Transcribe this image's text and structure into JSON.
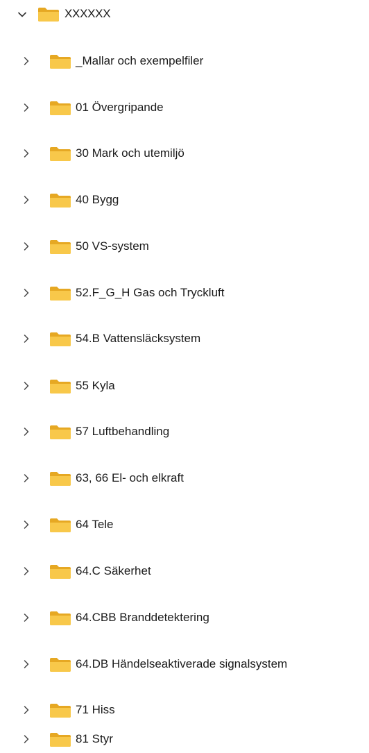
{
  "tree": {
    "root": {
      "label": "XXXXXX",
      "expanded": true,
      "chevron_icon": "chevron-down-icon",
      "folder_icon": "folder-icon"
    },
    "folder_color": "#f8c84a",
    "folder_dark": "#e6a823",
    "children": [
      {
        "label": "_Mallar och exempelfiler"
      },
      {
        "label": "01 Övergripande"
      },
      {
        "label": "30 Mark och utemiljö"
      },
      {
        "label": "40 Bygg"
      },
      {
        "label": "50 VS-system"
      },
      {
        "label": "52.F_G_H Gas och Tryckluft"
      },
      {
        "label": "54.B Vattensläcksystem"
      },
      {
        "label": "55 Kyla"
      },
      {
        "label": "57 Luftbehandling"
      },
      {
        "label": "63, 66 El- och elkraft"
      },
      {
        "label": "64 Tele"
      },
      {
        "label": "64.C Säkerhet"
      },
      {
        "label": "64.CBB Branddetektering"
      },
      {
        "label": "64.DB Händelseaktiverade signalsystem"
      },
      {
        "label": "71 Hiss"
      },
      {
        "label": "81 Styr"
      }
    ]
  }
}
